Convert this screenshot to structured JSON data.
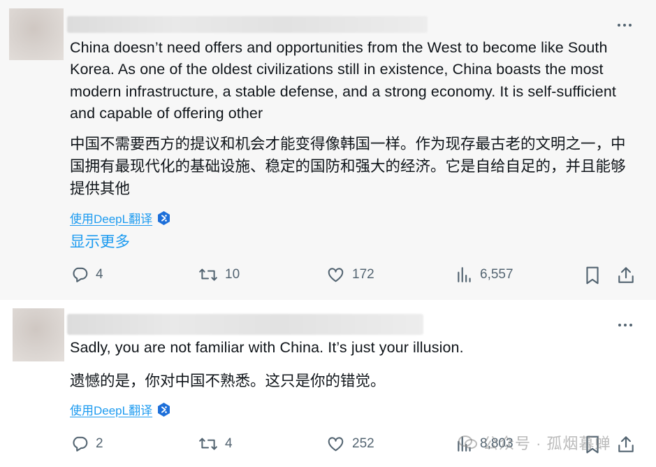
{
  "posts": [
    {
      "text_en": "China doesn’t need offers and opportunities from the West to become like South Korea. As one of the oldest civilizations still in existence, China boasts the most modern infrastructure, a stable defense, and a strong economy. It is self-sufficient and capable of offering other",
      "text_zh": "中国不需要西方的提议和机会才能变得像韩国一样。作为现存最古老的文明之一，中国拥有最现代化的基础设施、稳定的国防和强大的经济。它是自给自足的，并且能够提供其他",
      "translate_label": "使用DeepL翻译",
      "show_more_label": "显示更多",
      "replies": "4",
      "reposts": "10",
      "likes": "172",
      "views": "6,557"
    },
    {
      "text_en": "Sadly, you are not familiar with China. It’s just your illusion.",
      "text_zh": "遗憾的是，你对中国不熟悉。这只是你的错觉。",
      "translate_label": "使用DeepL翻译",
      "replies": "2",
      "reposts": "4",
      "likes": "252",
      "views": "8,803"
    }
  ],
  "watermark": {
    "text": "公众号 · 孤烟暮蝉"
  },
  "icons": {
    "more": "more-horizontal-icon",
    "reply": "reply-bubble-icon",
    "repost": "repost-icon",
    "like": "heart-icon",
    "views": "views-bar-chart-icon",
    "bookmark": "bookmark-icon",
    "share": "share-icon",
    "deepl": "deepl-logo-icon"
  },
  "colors": {
    "link": "#1d9bf0",
    "muted": "#536471",
    "text": "#0f1419"
  }
}
